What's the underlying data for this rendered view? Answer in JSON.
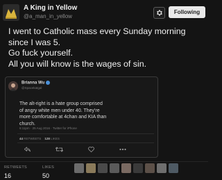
{
  "profile": {
    "name": "A King in Yellow",
    "handle": "@a_man_in_yellow",
    "follow_label": "Following"
  },
  "tweet": {
    "lines": [
      "I went to Catholic mass every Sunday morning",
      "since I was 5.",
      "Go fuck yourself.",
      "All you will know is the wages of sin."
    ]
  },
  "quoted_tweet": {
    "name": "Brianna Wu",
    "handle": "@Spacekatgal",
    "lines": [
      "The alt-right is a hate group comprised",
      "of angry white men under 40. They're",
      "more comfortable at 4chan and KIA than",
      "church."
    ],
    "meta": "6:11pm · 25 Aug 2016 · Twitter for iPhone",
    "retweets_count": "44",
    "retweets_label": "RETWEETS",
    "likes_count": "128",
    "likes_label": "LIKES"
  },
  "stats": {
    "retweets_label": "RETWEETS",
    "retweets_value": "16",
    "likes_label": "LIKES",
    "likes_value": "50"
  },
  "icons": {
    "settings": "gear-icon",
    "reply": "reply-icon",
    "retweet": "retweet-icon",
    "like": "heart-icon",
    "more": "more-icon"
  },
  "colors": {
    "background": "#141414",
    "follow_button": "#e9e9e9",
    "verified": "#4a90d9"
  }
}
